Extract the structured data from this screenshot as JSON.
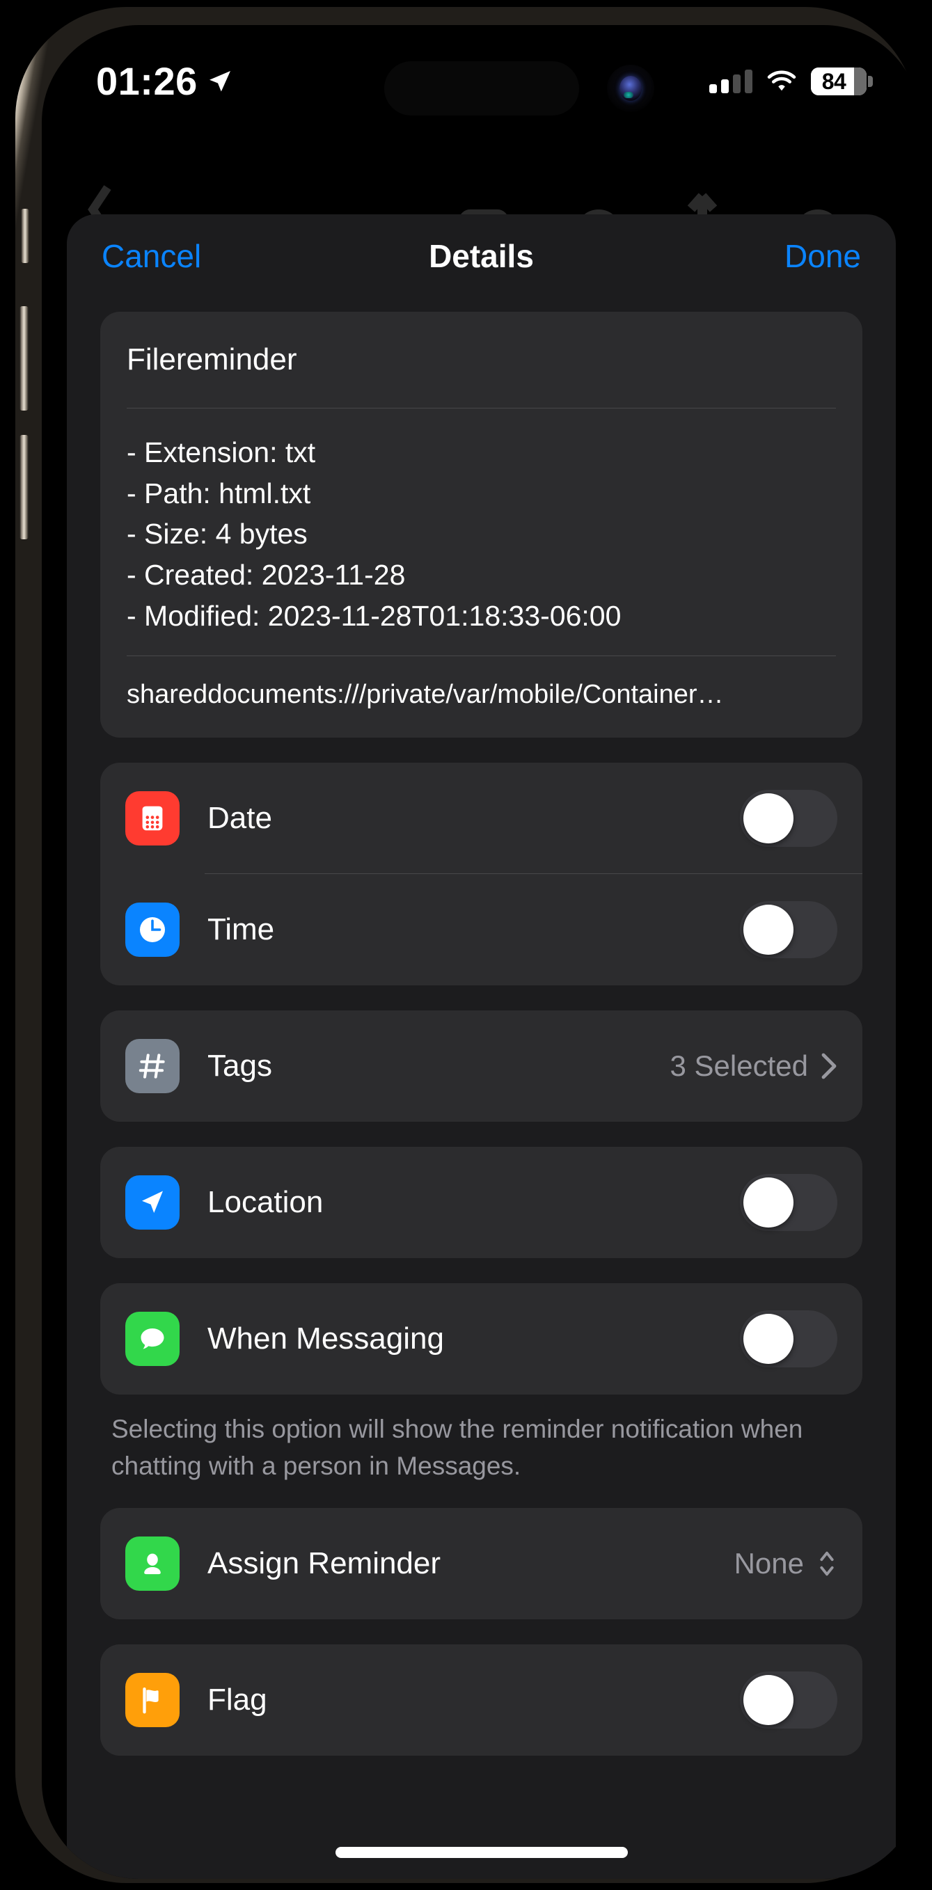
{
  "status_bar": {
    "time": "01:26",
    "location_icon": "location-arrow-icon",
    "signal_icon": "cellular-signal-icon",
    "signal_bars_filled": 2,
    "signal_bars_total": 4,
    "wifi_icon": "wifi-icon",
    "battery_percent": "84",
    "battery_icon": "battery-icon"
  },
  "nav_bar": {
    "cancel_label": "Cancel",
    "title": "Details",
    "done_label": "Done"
  },
  "info_card": {
    "title": "Filereminder",
    "metadata": [
      "- Extension: txt",
      "- Path: html.txt",
      "- Size: 4 bytes",
      "- Created: 2023-11-28",
      "- Modified: 2023-11-28T01:18:33-06:00"
    ],
    "url": "shareddocuments:///private/var/mobile/Container…"
  },
  "rows": {
    "date": {
      "label": "Date",
      "icon": "calendar-icon",
      "icon_color": "#ff3b30",
      "toggle_on": false
    },
    "time": {
      "label": "Time",
      "icon": "clock-icon",
      "icon_color": "#0a84ff",
      "toggle_on": false
    },
    "tags": {
      "label": "Tags",
      "icon": "hash-icon",
      "icon_color": "#78828e",
      "value": "3 Selected",
      "accessory": "chevron-right-icon"
    },
    "location": {
      "label": "Location",
      "icon": "location-arrow-icon",
      "icon_color": "#0a84ff",
      "toggle_on": false
    },
    "when_messaging": {
      "label": "When Messaging",
      "icon": "message-bubble-icon",
      "icon_color": "#32d74b",
      "toggle_on": false,
      "footer_note": "Selecting this option will show the reminder notification when chatting with a person in Messages."
    },
    "assign_reminder": {
      "label": "Assign Reminder",
      "icon": "person-icon",
      "icon_color": "#32d74b",
      "value": "None",
      "accessory": "up-down-chevron-icon"
    },
    "flag": {
      "label": "Flag",
      "icon": "flag-icon",
      "icon_color": "#ff9f0a",
      "toggle_on": false
    }
  },
  "colors": {
    "accent_blue": "#0a84ff",
    "sheet_background": "#1c1c1e",
    "card_background": "#2c2c2e",
    "toggle_off_track": "#39393d",
    "secondary_text": "#98989f"
  }
}
